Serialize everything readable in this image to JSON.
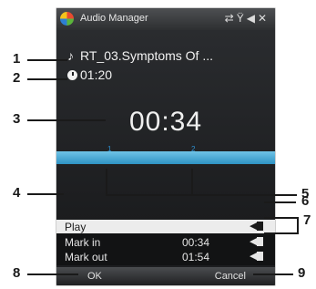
{
  "app": {
    "title": "Audio Manager",
    "tray_icons": [
      "sync-icon",
      "signal-icon",
      "volume-icon",
      "close-icon"
    ]
  },
  "track": {
    "name": "RT_03.Symptoms Of ...",
    "duration": "01:20"
  },
  "player": {
    "elapsed": "00:34",
    "marker_in": "1",
    "marker_out": "2"
  },
  "menu": [
    {
      "label": "Play",
      "time": "",
      "selected": true
    },
    {
      "label": "Mark in",
      "time": "00:34",
      "selected": false
    },
    {
      "label": "Mark out",
      "time": "01:54",
      "selected": false
    }
  ],
  "softkeys": {
    "left": "OK",
    "right": "Cancel"
  },
  "callouts": [
    "1",
    "2",
    "3",
    "4",
    "5",
    "6",
    "7",
    "8",
    "9"
  ]
}
